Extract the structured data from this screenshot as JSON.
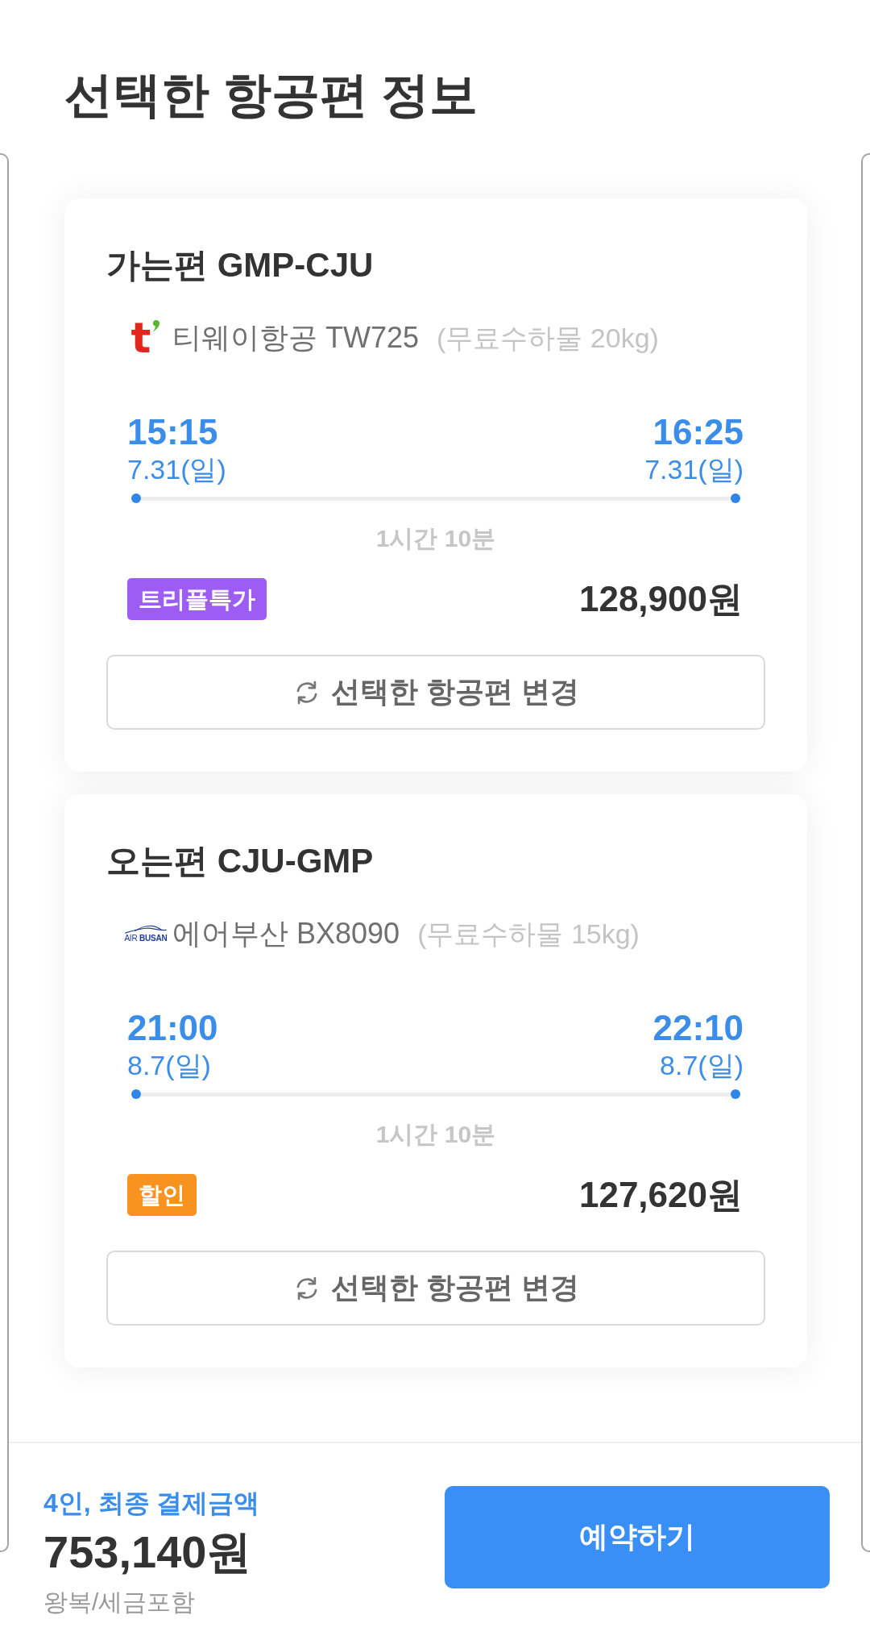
{
  "title": "선택한 항공편 정보",
  "flights": [
    {
      "heading": "가는편 GMP-CJU",
      "airline": {
        "kind": "letter",
        "logo_text": "t",
        "name": "티웨이항공 TW725",
        "baggage": "(무료수하물 20kg)"
      },
      "departure": {
        "time": "15:15",
        "date": "7.31(일)"
      },
      "arrival": {
        "time": "16:25",
        "date": "7.31(일)"
      },
      "duration": "1시간 10분",
      "badge": {
        "label": "트리플특가",
        "color": "#9d5cf4"
      },
      "price": "128,900원",
      "change_button": "선택한 항공편 변경"
    },
    {
      "heading": "오는편 CJU-GMP",
      "airline": {
        "kind": "wordmark",
        "logo_text": "AIR **BUSAN**",
        "name": "에어부산 BX8090",
        "baggage": "(무료수하물 15kg)"
      },
      "departure": {
        "time": "21:00",
        "date": "8.7(일)"
      },
      "arrival": {
        "time": "22:10",
        "date": "8.7(일)"
      },
      "duration": "1시간 10분",
      "badge": {
        "label": "할인",
        "color": "#f7931e"
      },
      "price": "127,620원",
      "change_button": "선택한 항공편 변경"
    }
  ],
  "summary": {
    "label": "4인, 최종 결제금액",
    "total": "753,140원",
    "note": "왕복/세금포함"
  },
  "book_button": "예약하기"
}
